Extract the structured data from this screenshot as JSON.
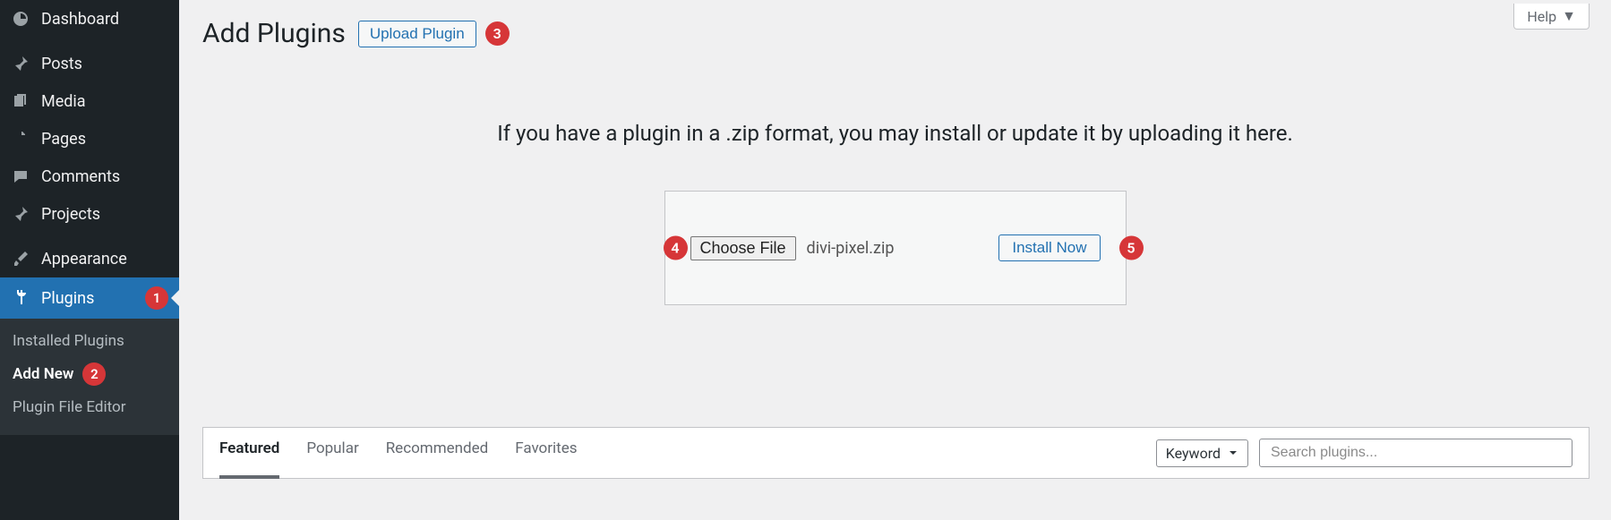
{
  "sidebar": {
    "items": [
      {
        "label": "Dashboard",
        "icon": "dashboard"
      },
      {
        "label": "Posts",
        "icon": "pin"
      },
      {
        "label": "Media",
        "icon": "media"
      },
      {
        "label": "Pages",
        "icon": "page"
      },
      {
        "label": "Comments",
        "icon": "comment"
      },
      {
        "label": "Projects",
        "icon": "pin"
      },
      {
        "label": "Appearance",
        "icon": "brush"
      },
      {
        "label": "Plugins",
        "icon": "plugin",
        "badge": "1",
        "current": true
      }
    ],
    "submenu": {
      "installed": "Installed Plugins",
      "add_new": {
        "label": "Add New",
        "badge": "2"
      },
      "file_editor": "Plugin File Editor"
    }
  },
  "header": {
    "help": "Help",
    "title": "Add Plugins",
    "upload_btn": "Upload Plugin",
    "upload_badge": "3"
  },
  "upload": {
    "message": "If you have a plugin in a .zip format, you may install or update it by uploading it here.",
    "choose_label": "Choose File",
    "file_name": "divi-pixel.zip",
    "install_label": "Install Now",
    "badge_choose": "4",
    "badge_install": "5"
  },
  "filter": {
    "tabs": {
      "featured": "Featured",
      "popular": "Popular",
      "recommended": "Recommended",
      "favorites": "Favorites"
    },
    "search_type": "Keyword",
    "search_placeholder": "Search plugins..."
  }
}
